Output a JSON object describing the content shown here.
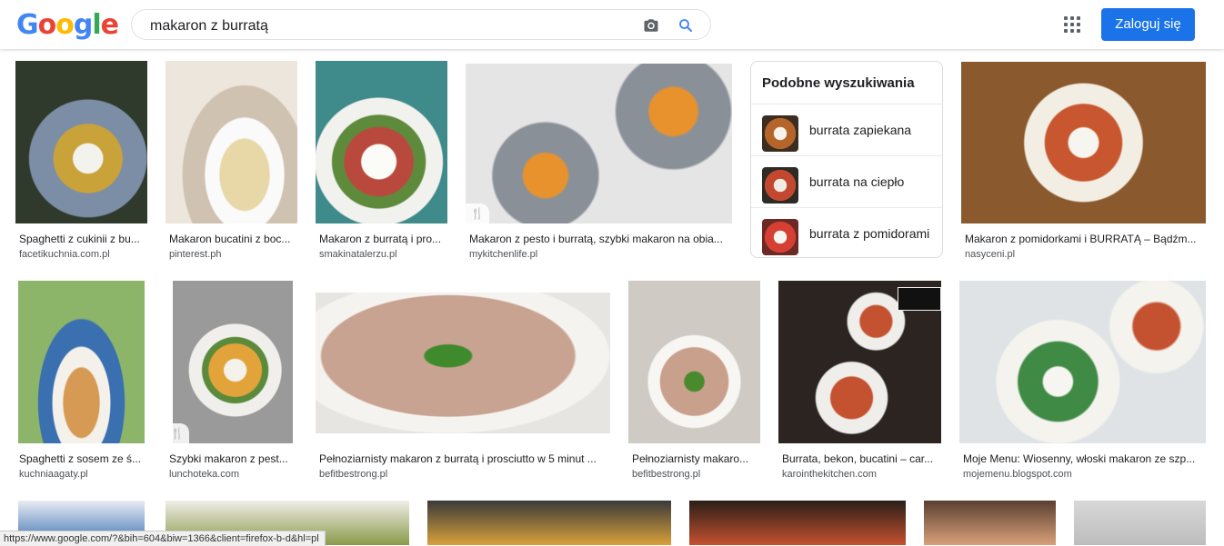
{
  "header": {
    "logo": [
      "G",
      "o",
      "o",
      "g",
      "l",
      "e"
    ],
    "search_value": "makaron z burratą",
    "login_label": "Zaloguj się"
  },
  "related": {
    "title": "Podobne wyszukiwania",
    "items": [
      {
        "label": "burrata zapiekana"
      },
      {
        "label": "burrata na ciepło"
      },
      {
        "label": "burrata z pomidorami"
      }
    ]
  },
  "results_row1": [
    {
      "title": "Spaghetti z cukinii z bu...",
      "source": "facetikuchnia.com.pl"
    },
    {
      "title": "Makaron bucatini z boc...",
      "source": "pinterest.ph"
    },
    {
      "title": "Makaron z burratą i pro...",
      "source": "smakinatalerzu.pl"
    },
    {
      "title": "Makaron z pesto i burratą, szybki makaron na obia...",
      "source": "mykitchenlife.pl"
    },
    {
      "title": "Makaron z pomidorkami i BURRATĄ – Bądźm...",
      "source": "nasyceni.pl"
    }
  ],
  "results_row2": [
    {
      "title": "Spaghetti z sosem ze ś...",
      "source": "kuchniaagaty.pl"
    },
    {
      "title": "Szybki makaron z pest...",
      "source": "lunchoteka.com"
    },
    {
      "title": "Pełnoziarnisty makaron z burratą i prosciutto w 5 minut ...",
      "source": "befitbestrong.pl"
    },
    {
      "title": "Pełnoziarnisty makaro...",
      "source": "befitbestrong.pl"
    },
    {
      "title": "Burrata, bekon, bucatini – car...",
      "source": "karointhekitchen.com"
    },
    {
      "title": "Moje Menu: Wiosenny, włoski makaron ze szp...",
      "source": "mojemenu.blogspot.com"
    }
  ],
  "status_url": "https://www.google.com/?&bih=604&biw=1366&client=firefox-b-d&hl=pl",
  "colors": {
    "accent": "#1a73e8",
    "logo": [
      "#4285f4",
      "#ea4335",
      "#fbbc05",
      "#4285f4",
      "#34a853",
      "#ea4335"
    ]
  }
}
